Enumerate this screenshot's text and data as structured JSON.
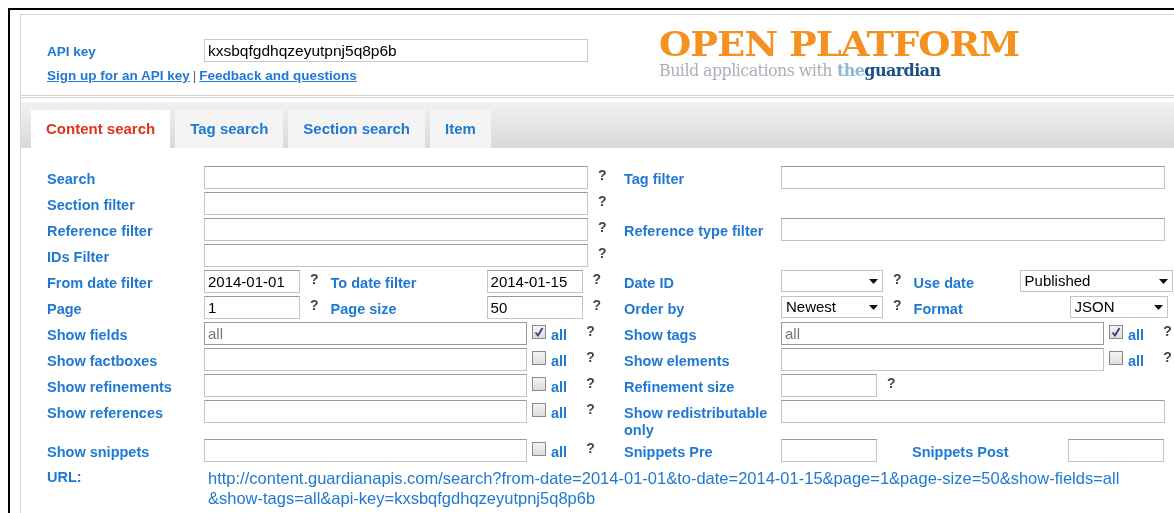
{
  "header": {
    "api_key": {
      "label": "API key",
      "value": "kxsbqfgdhqzeyutpnj5q8p6b"
    },
    "links": [
      {
        "text": "Sign up for an API key"
      },
      {
        "text": "Feedback and questions"
      }
    ],
    "separator": "|",
    "logo": {
      "title": "OPEN PLATFORM",
      "tagline": "Build applications with",
      "brand_prefix": "the",
      "brand": "guardian"
    }
  },
  "tabs": [
    {
      "label": "Content search",
      "selected": true
    },
    {
      "label": "Tag search",
      "selected": false
    },
    {
      "label": "Section search",
      "selected": false
    },
    {
      "label": "Item",
      "selected": false
    }
  ],
  "rows": [
    {
      "left": [
        {
          "kind": "label",
          "text": "Search"
        },
        {
          "kind": "input"
        },
        {
          "kind": "help",
          "text": "?"
        }
      ],
      "right": [
        {
          "kind": "label",
          "text": "Tag filter"
        },
        {
          "kind": "input"
        }
      ]
    },
    {
      "left": [
        {
          "kind": "label",
          "text": "Section filter"
        },
        {
          "kind": "input"
        },
        {
          "kind": "help",
          "text": "?"
        }
      ],
      "right": []
    },
    {
      "left": [
        {
          "kind": "label",
          "text": "Reference filter"
        },
        {
          "kind": "input"
        },
        {
          "kind": "help",
          "text": "?"
        }
      ],
      "right": [
        {
          "kind": "label",
          "text": "Reference type filter"
        },
        {
          "kind": "input"
        }
      ]
    },
    {
      "left": [
        {
          "kind": "label",
          "text": "IDs Filter"
        },
        {
          "kind": "input"
        },
        {
          "kind": "help",
          "text": "?"
        }
      ],
      "right": []
    },
    {
      "left": [
        {
          "kind": "label",
          "text": "From date filter"
        },
        {
          "kind": "short-input",
          "value": "2014-01-01"
        },
        {
          "kind": "help",
          "text": "?"
        },
        {
          "kind": "label",
          "text": "To date filter"
        },
        {
          "kind": "short-input",
          "value": "2014-01-15"
        },
        {
          "kind": "help",
          "text": "?"
        }
      ],
      "right": [
        {
          "kind": "label",
          "text": "Date ID"
        },
        {
          "kind": "select"
        },
        {
          "kind": "help",
          "text": "?"
        },
        {
          "kind": "label",
          "text": "Use date"
        },
        {
          "kind": "long-select",
          "value": "Published"
        }
      ]
    },
    {
      "left": [
        {
          "kind": "label",
          "text": "Page"
        },
        {
          "kind": "short-input",
          "value": "1"
        },
        {
          "kind": "help",
          "text": "?"
        },
        {
          "kind": "label",
          "text": "Page size"
        },
        {
          "kind": "short-input",
          "value": "50"
        },
        {
          "kind": "help",
          "text": "?"
        }
      ],
      "right": [
        {
          "kind": "label",
          "text": "Order by"
        },
        {
          "kind": "select",
          "value": "Newest"
        },
        {
          "kind": "help",
          "text": "?"
        },
        {
          "kind": "label",
          "text": "Format"
        },
        {
          "kind": "short-select",
          "value": "JSON"
        }
      ]
    },
    {
      "left": [
        {
          "kind": "label",
          "text": "Show fields"
        },
        {
          "kind": "medium-input",
          "value": "all",
          "disabled": true
        },
        {
          "kind": "checkbox",
          "label": "all",
          "checked": true
        },
        {
          "kind": "help",
          "text": "?"
        }
      ],
      "right": [
        {
          "kind": "label",
          "text": "Show tags"
        },
        {
          "kind": "medium-input",
          "value": "all",
          "disabled": true
        },
        {
          "kind": "checkbox",
          "label": "all",
          "checked": true
        },
        {
          "kind": "help",
          "text": "?"
        }
      ]
    },
    {
      "left": [
        {
          "kind": "label",
          "text": "Show factboxes"
        },
        {
          "kind": "medium-input"
        },
        {
          "kind": "checkbox",
          "label": "all",
          "checked": false
        },
        {
          "kind": "help",
          "text": "?"
        }
      ],
      "right": [
        {
          "kind": "label",
          "text": "Show elements"
        },
        {
          "kind": "medium-input"
        },
        {
          "kind": "checkbox",
          "label": "all",
          "checked": false
        },
        {
          "kind": "help",
          "text": "?"
        }
      ]
    },
    {
      "left": [
        {
          "kind": "label",
          "text": "Show refinements"
        },
        {
          "kind": "medium-input"
        },
        {
          "kind": "checkbox",
          "label": "all",
          "checked": false
        },
        {
          "kind": "help",
          "text": "?"
        }
      ],
      "right": [
        {
          "kind": "label",
          "text": "Refinement size"
        },
        {
          "kind": "short-input"
        },
        {
          "kind": "help",
          "text": "?"
        }
      ]
    },
    {
      "left": [
        {
          "kind": "label",
          "text": "Show references"
        },
        {
          "kind": "medium-input"
        },
        {
          "kind": "checkbox",
          "label": "all",
          "checked": false
        },
        {
          "kind": "help",
          "text": "?"
        }
      ],
      "right": [
        {
          "kind": "label",
          "text": "Show redistributable only"
        },
        {
          "kind": "input"
        }
      ]
    },
    {
      "left": [
        {
          "kind": "label",
          "text": "Show snippets"
        },
        {
          "kind": "medium-input"
        },
        {
          "kind": "checkbox",
          "label": "all",
          "checked": false
        },
        {
          "kind": "help",
          "text": "?"
        }
      ],
      "right": [
        {
          "kind": "label",
          "text": "Snippets Pre"
        },
        {
          "kind": "short-input"
        },
        {
          "kind": "label",
          "text": "Snippets Post"
        },
        {
          "kind": "short-input"
        }
      ]
    }
  ],
  "url": {
    "label": "URL:",
    "value": "http://content.guardianapis.com/search?from-date=2014-01-01&to-date=2014-01-15&page=1&page-size=50&show-fields=all&show-tags=all&api-key=kxsbqfgdhqzeyutpnj5q8p6b"
  }
}
